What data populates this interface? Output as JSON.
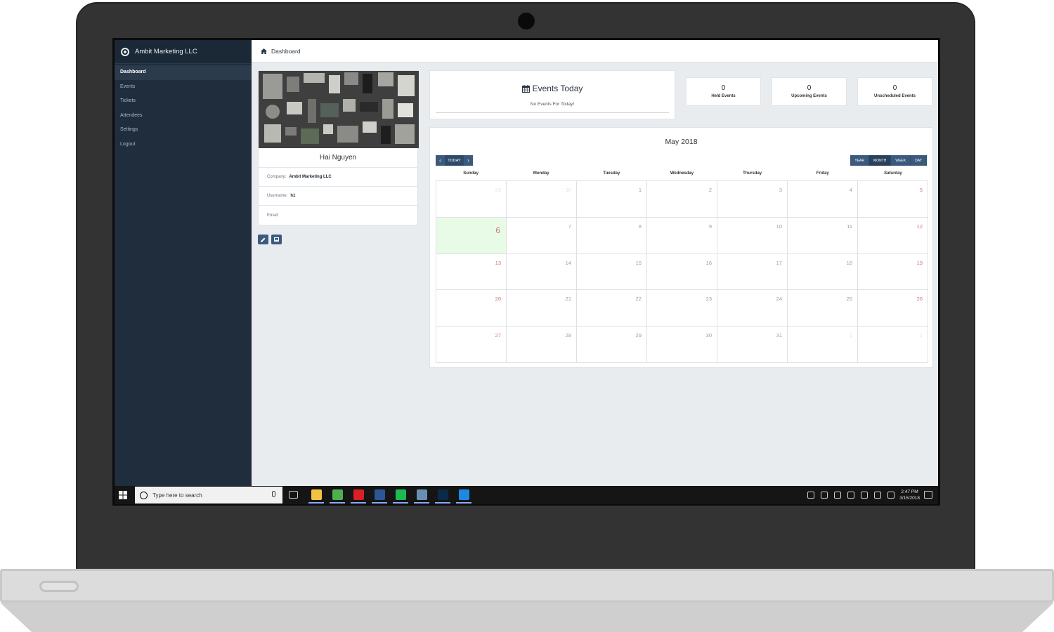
{
  "sidebar": {
    "brand": "Ambit Marketing LLC",
    "items": [
      {
        "label": "Dashboard",
        "active": true
      },
      {
        "label": "Events",
        "active": false
      },
      {
        "label": "Tickets",
        "active": false
      },
      {
        "label": "Attendees",
        "active": false
      },
      {
        "label": "Settings",
        "active": false
      },
      {
        "label": "Logout",
        "active": false
      }
    ]
  },
  "topbar": {
    "breadcrumb": "Dashboard"
  },
  "profile": {
    "name": "Hai Nguyen",
    "company_label": "Company:",
    "company": "Ambit Marketing LLC",
    "username_label": "Username:",
    "username": "h1",
    "email_label": "Email:",
    "email": ""
  },
  "events_today": {
    "title": "Events Today",
    "subtitle": "No Events For Today!"
  },
  "stats": [
    {
      "value": "0",
      "label": "Held Events"
    },
    {
      "value": "0",
      "label": "Upcoming Events"
    },
    {
      "value": "0",
      "label": "Unscheduled Events"
    }
  ],
  "calendar": {
    "title": "May 2018",
    "today_label": "TODAY",
    "views": [
      "YEAR",
      "MONTH",
      "WEEK",
      "DAY"
    ],
    "active_view": "MONTH",
    "weekdays": [
      "Sunday",
      "Monday",
      "Tuesday",
      "Wednesday",
      "Thursday",
      "Friday",
      "Saturday"
    ],
    "today": 6,
    "weeks": [
      [
        {
          "d": 29,
          "other": true
        },
        {
          "d": 30,
          "other": true
        },
        {
          "d": 1
        },
        {
          "d": 2
        },
        {
          "d": 3
        },
        {
          "d": 4
        },
        {
          "d": 5
        }
      ],
      [
        {
          "d": 6
        },
        {
          "d": 7
        },
        {
          "d": 8
        },
        {
          "d": 9
        },
        {
          "d": 10
        },
        {
          "d": 11
        },
        {
          "d": 12
        }
      ],
      [
        {
          "d": 13
        },
        {
          "d": 14
        },
        {
          "d": 15
        },
        {
          "d": 16
        },
        {
          "d": 17
        },
        {
          "d": 18
        },
        {
          "d": 19
        }
      ],
      [
        {
          "d": 20
        },
        {
          "d": 21
        },
        {
          "d": 22
        },
        {
          "d": 23
        },
        {
          "d": 24
        },
        {
          "d": 25
        },
        {
          "d": 26
        }
      ],
      [
        {
          "d": 27
        },
        {
          "d": 28
        },
        {
          "d": 29
        },
        {
          "d": 30
        },
        {
          "d": 31
        },
        {
          "d": 1,
          "other": true
        },
        {
          "d": 2,
          "other": true
        }
      ]
    ]
  },
  "taskbar": {
    "search_placeholder": "Type here to search",
    "time": "2:47 PM",
    "date": "3/15/2018",
    "apps": [
      {
        "name": "file-explorer-icon",
        "color": "#f2c343"
      },
      {
        "name": "chrome-icon",
        "color": "#4caf50"
      },
      {
        "name": "creative-cloud-icon",
        "color": "#da1f26"
      },
      {
        "name": "word-icon",
        "color": "#2b5797"
      },
      {
        "name": "spotify-icon",
        "color": "#1db954"
      },
      {
        "name": "steam-icon",
        "color": "#6a8fb5"
      },
      {
        "name": "photoshop-icon",
        "color": "#0b2a4a"
      },
      {
        "name": "edge-icon",
        "color": "#1e88e5"
      }
    ]
  },
  "colors": {
    "sidebar_bg": "#1f2d3d",
    "accent": "#3c5a7d",
    "today_bg": "#e8fbe6",
    "weekend_text": "#c97a7a"
  }
}
